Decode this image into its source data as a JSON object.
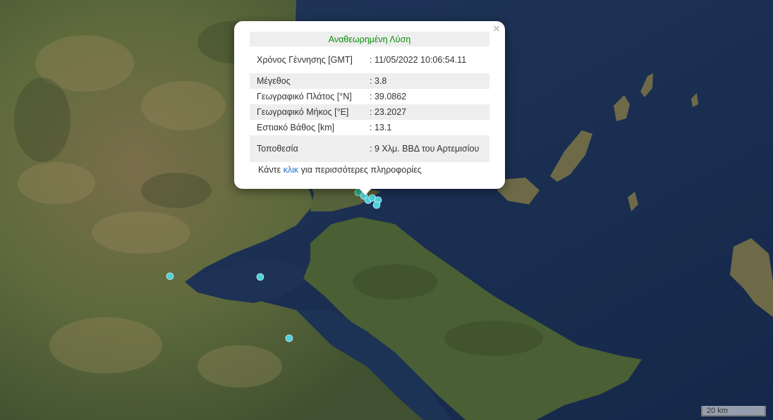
{
  "popup": {
    "title": "Αναθεωρημένη Λύση",
    "close_symbol": "×",
    "rows": [
      {
        "label": "Χρόνος Γέννησης [GMT]",
        "value": ": 11/05/2022 10:06:54.11"
      },
      {
        "label": "Μέγεθος",
        "value": ": 3.8"
      },
      {
        "label": "Γεωγραφικό Πλάτος [°N]",
        "value": ": 39.0862"
      },
      {
        "label": "Γεωγραφικό Μήκος [°E]",
        "value": ": 23.2027"
      },
      {
        "label": "Εστιακό Βάθος [km]",
        "value": ": 13.1"
      },
      {
        "label": "Τοποθεσία",
        "value": ": 9 Χλμ. ΒΒΔ του Αρτεμισίου"
      }
    ],
    "more_prefix": "Κάντε ",
    "more_link": "κλικ",
    "more_suffix": " για περισσότερες πληροφορίες"
  },
  "scale_bar": {
    "label": "20 km"
  },
  "colors": {
    "sea": "#1b2f4a",
    "land": "#5a6a3c",
    "marker": "#4dd0dc",
    "title_green": "#0a8f0a",
    "link_blue": "#1f6fc5"
  }
}
